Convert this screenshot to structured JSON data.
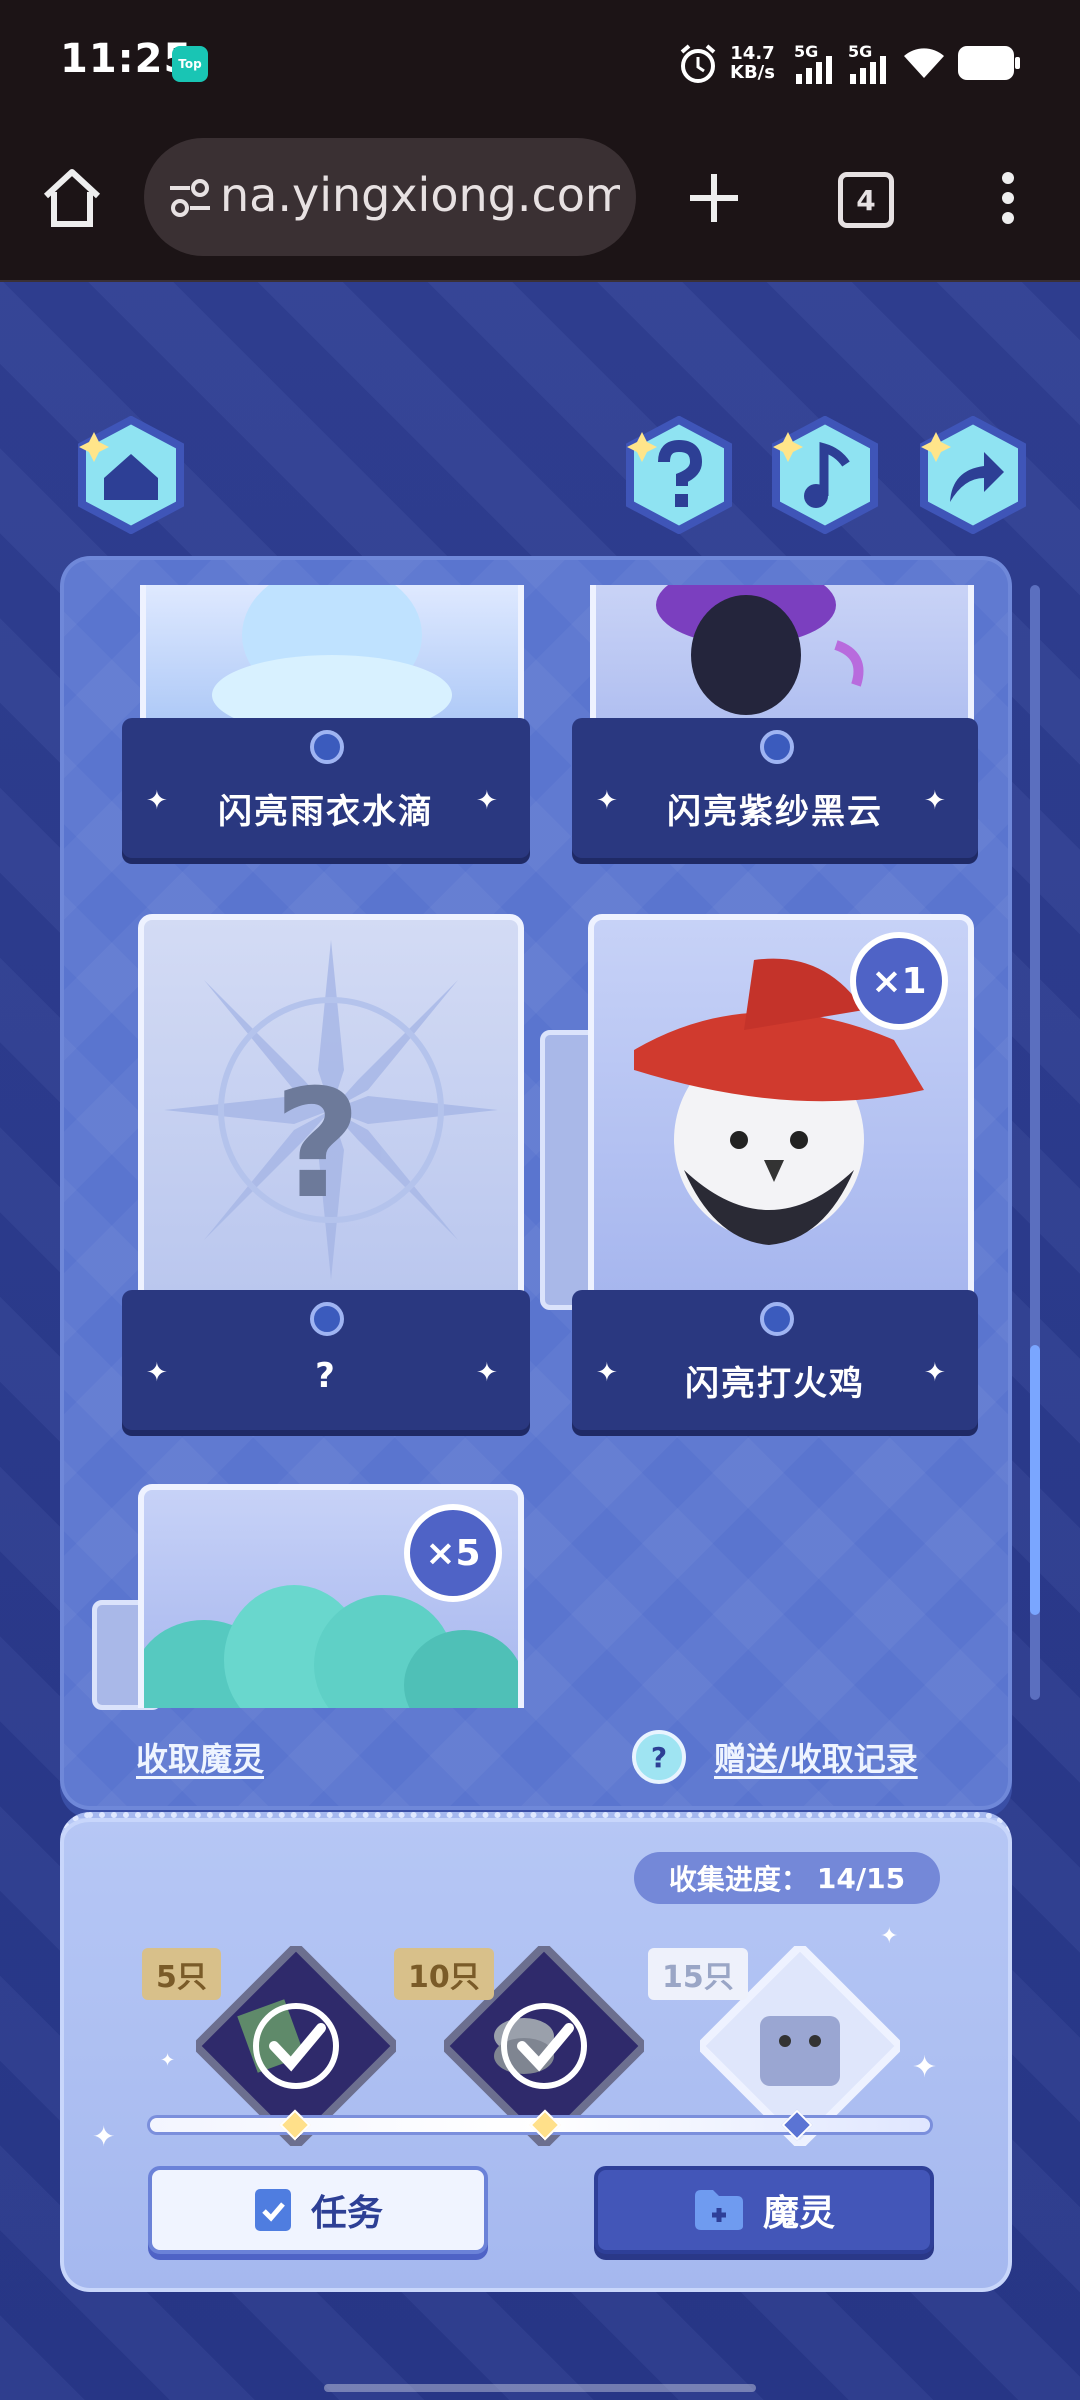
{
  "status_bar": {
    "time": "11:25",
    "app_badge": "Top",
    "net_speed": "14.7",
    "net_unit": "KB/s",
    "signal_1": "5G",
    "signal_2": "5G"
  },
  "browser": {
    "url": "na.yingxiong.com",
    "tab_count": "4"
  },
  "cards": [
    {
      "label": "闪亮雨衣水滴"
    },
    {
      "label": "闪亮紫纱黑云"
    },
    {
      "label": "?",
      "image_text": "?"
    },
    {
      "label": "闪亮打火鸡",
      "count": "×1"
    },
    {
      "label": "",
      "count": "×5"
    }
  ],
  "panel_links": {
    "collect": "收取魔灵",
    "help_icon": "?",
    "records": "赠送/收取记录"
  },
  "progress": {
    "label": "收集进度：",
    "value": "14/15",
    "collected": 14,
    "total": 15
  },
  "milestones": [
    {
      "tag": "5只",
      "done": true
    },
    {
      "tag": "10只",
      "done": true
    },
    {
      "tag": "15只",
      "done": false
    }
  ],
  "buttons": {
    "task": "任务",
    "sprite": "魔灵"
  },
  "colors": {
    "accent": "#4356b8",
    "panel": "#5a75cf",
    "background": "#2f3f93"
  }
}
